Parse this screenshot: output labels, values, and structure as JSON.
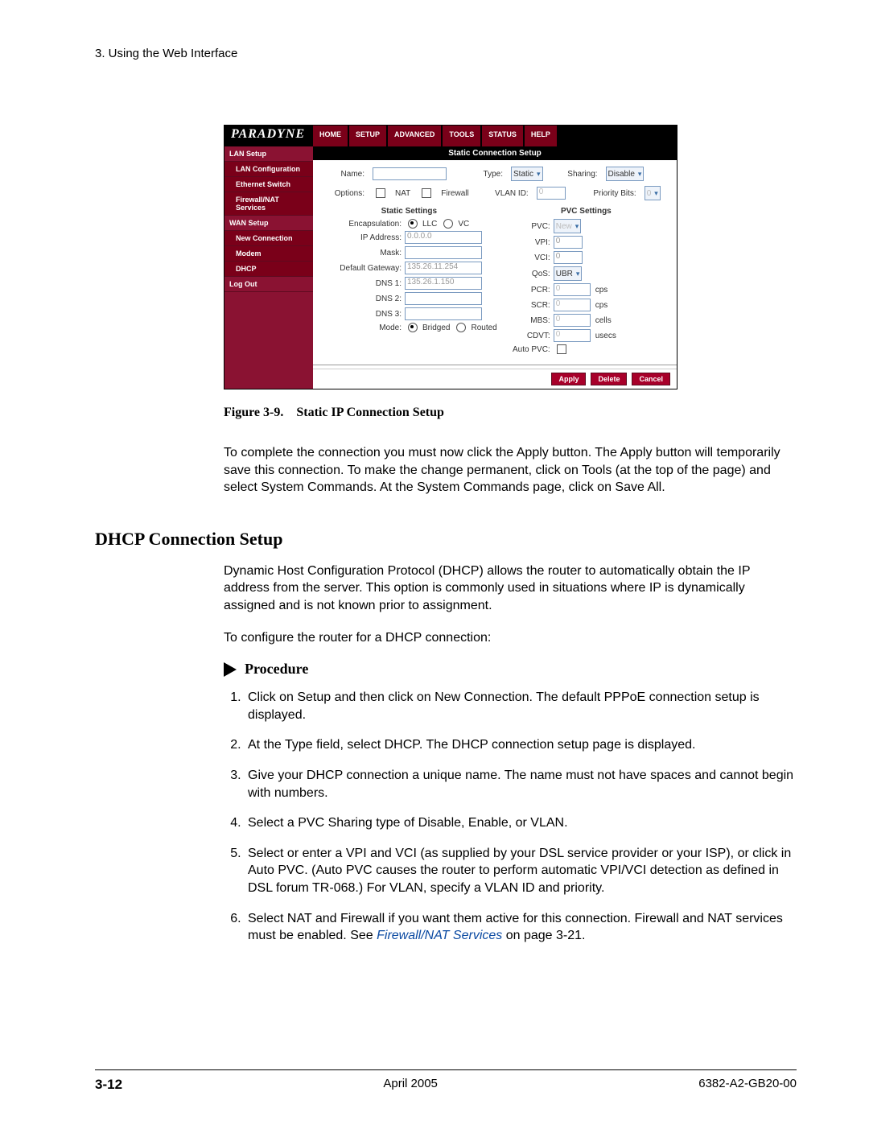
{
  "header": {
    "chapter": "3. Using the Web Interface"
  },
  "router": {
    "brand": "PARADYNE",
    "tabs": [
      "HOME",
      "SETUP",
      "ADVANCED",
      "TOOLS",
      "STATUS",
      "HELP"
    ],
    "sidebar": {
      "cat1": "LAN Setup",
      "items1": [
        "LAN Configuration",
        "Ethernet Switch",
        "Firewall/NAT Services"
      ],
      "cat2": "WAN Setup",
      "items2": [
        "New Connection",
        "Modem",
        "DHCP",
        "Log Out"
      ]
    },
    "panel_title": "Static Connection Setup",
    "labels": {
      "name": "Name:",
      "type": "Type:",
      "sharing": "Sharing:",
      "options": "Options:",
      "nat": "NAT",
      "firewall": "Firewall",
      "vlan": "VLAN ID:",
      "priority": "Priority Bits:",
      "static_settings": "Static Settings",
      "encap": "Encapsulation:",
      "llc": "LLC",
      "vc": "VC",
      "ip": "IP Address:",
      "mask": "Mask:",
      "gw": "Default Gateway:",
      "dns1": "DNS 1:",
      "dns2": "DNS 2:",
      "dns3": "DNS 3:",
      "mode": "Mode:",
      "bridged": "Bridged",
      "routed": "Routed",
      "pvc_settings": "PVC Settings",
      "pvc": "PVC:",
      "vpi": "VPI:",
      "vci": "VCI:",
      "qos": "QoS:",
      "pcr": "PCR:",
      "scr": "SCR:",
      "mbs": "MBS:",
      "cdvt": "CDVT:",
      "autopvc": "Auto PVC:",
      "cps": "cps",
      "cells": "cells",
      "usecs": "usecs"
    },
    "values": {
      "type": "Static",
      "sharing": "Disable",
      "vlan": "0",
      "priority": "0",
      "ip": "0.0.0.0",
      "gw": "135.26.11.254",
      "dns1": "135.26.1.150",
      "pvc": "New",
      "vpi": "0",
      "vci": "0",
      "qos": "UBR",
      "pcr": "0",
      "scr": "0",
      "mbs": "0",
      "cdvt": "0"
    },
    "buttons": {
      "apply": "Apply",
      "delete": "Delete",
      "cancel": "Cancel"
    }
  },
  "caption": "Figure 3-9. Static IP Connection Setup",
  "para1": "To complete the connection you must now click the Apply button. The Apply button will temporarily save this connection. To make the change permanent, click on Tools (at the top of the page) and select System Commands. At the System Commands page, click on Save All.",
  "section_title": "DHCP Connection Setup",
  "para2": "Dynamic Host Configuration Protocol (DHCP) allows the router to automatically obtain the IP address from the server. This option is commonly used in situations where IP is dynamically assigned and is not known prior to assignment.",
  "para3": "To configure the router for a DHCP connection:",
  "procedure_title": "Procedure",
  "steps": {
    "s1": "Click on Setup and then click on New Connection. The default PPPoE connection setup is displayed.",
    "s2": "At the Type field, select DHCP. The DHCP connection setup page is displayed.",
    "s3": "Give your DHCP connection a unique name. The name must not have spaces and cannot begin with numbers.",
    "s4": "Select a PVC Sharing type of Disable, Enable, or VLAN.",
    "s5": "Select or enter a VPI and VCI (as supplied by your DSL service provider or your ISP), or click in Auto PVC. (Auto PVC causes the router to perform automatic VPI/VCI detection as defined in DSL forum TR-068.) For VLAN, specify a VLAN ID and priority.",
    "s6a": "Select NAT and Firewall if you want them active for this connection. Firewall and NAT services must be enabled. See ",
    "s6link": "Firewall/NAT Services",
    "s6b": " on page 3-21."
  },
  "footer": {
    "page": "3-12",
    "date": "April 2005",
    "doc": "6382-A2-GB20-00"
  }
}
